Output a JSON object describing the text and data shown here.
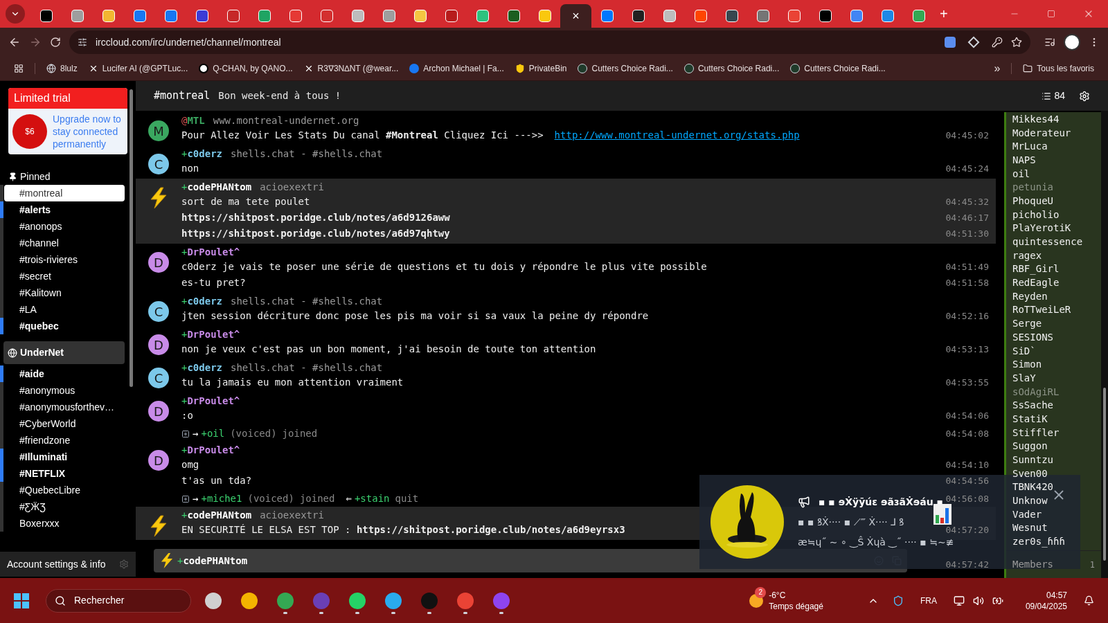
{
  "browser": {
    "tabs": [
      {
        "color": "#000000",
        "selected": false
      },
      {
        "color": "#9e9e9e",
        "selected": false
      },
      {
        "color": "#f2b631",
        "selected": false
      },
      {
        "color": "#1877f2",
        "selected": false
      },
      {
        "color": "#1877f2",
        "selected": false
      },
      {
        "color": "#3b3bd6",
        "selected": false
      },
      {
        "color": "#c62828",
        "selected": false
      },
      {
        "color": "#1fa463",
        "selected": false
      },
      {
        "color": "#e53935",
        "selected": false
      },
      {
        "color": "#d32f2f",
        "selected": false
      },
      {
        "color": "#bdbdbd",
        "selected": false
      },
      {
        "color": "#9e9e9e",
        "selected": false
      },
      {
        "color": "#f4c542",
        "selected": false
      },
      {
        "color": "#b71c1c",
        "selected": false
      },
      {
        "color": "#2ec27e",
        "selected": false
      },
      {
        "color": "#1b5e20",
        "selected": false
      },
      {
        "color": "#f9c80e",
        "selected": false
      },
      {
        "selected": true
      },
      {
        "color": "#0077ff",
        "selected": false
      },
      {
        "color": "#212121",
        "selected": false
      },
      {
        "color": "#bdbdbd",
        "selected": false
      },
      {
        "color": "#ff4500",
        "selected": false
      },
      {
        "color": "#37474f",
        "selected": false
      },
      {
        "color": "#757575",
        "selected": false
      },
      {
        "color": "#ea4335",
        "selected": false
      },
      {
        "color": "#000000",
        "selected": false
      },
      {
        "color": "#4285f4",
        "selected": false
      },
      {
        "color": "#1e88e5",
        "selected": false
      },
      {
        "color": "#34a853",
        "selected": false
      }
    ],
    "close_tab": "×",
    "new_tab": "+",
    "url": "irccloud.com/irc/undernet/channel/montreal",
    "bookmarks": [
      {
        "label": "8lulz",
        "kind": "globe"
      },
      {
        "label": "Lucifer AI (@GPTLuc...",
        "kind": "x"
      },
      {
        "label": "Q-CHAN, by QANO...",
        "kind": "q"
      },
      {
        "label": "R3∇3N∆NT (@wear...",
        "kind": "x"
      },
      {
        "label": "Archon Michael | Fa...",
        "kind": "fb"
      },
      {
        "label": "PrivateBin",
        "kind": "shield"
      },
      {
        "label": "Cutters Choice Radi...",
        "kind": "radio"
      },
      {
        "label": "Cutters Choice Radi...",
        "kind": "radio"
      },
      {
        "label": "Cutters Choice Radi...",
        "kind": "radio"
      }
    ],
    "more": "»",
    "all_bookmarks": "Tous les favoris"
  },
  "sidebar": {
    "trial": {
      "title": "Limited trial",
      "price": "$6",
      "text": "Upgrade now to stay connected permanently"
    },
    "pinned": {
      "title": "Pinned",
      "items": [
        {
          "label": "#montreal",
          "selected": true,
          "unread": false
        },
        {
          "label": "#alerts",
          "selected": false,
          "unread": true
        },
        {
          "label": "#anonops",
          "selected": false,
          "unread": false
        },
        {
          "label": "#channel",
          "selected": false,
          "unread": false
        },
        {
          "label": "#trois-rivieres",
          "selected": false,
          "unread": false
        },
        {
          "label": "#secret",
          "selected": false,
          "unread": false
        },
        {
          "label": "#Kalitown",
          "selected": false,
          "unread": false
        },
        {
          "label": "#LA",
          "selected": false,
          "unread": false
        },
        {
          "label": "#quebec",
          "selected": false,
          "unread": true
        }
      ]
    },
    "network": {
      "title": "UnderNet",
      "items": [
        {
          "label": "#aide",
          "selected": false,
          "unread": true
        },
        {
          "label": "#anonymous",
          "selected": false,
          "unread": false
        },
        {
          "label": "#anonymousforthev…",
          "selected": false,
          "unread": false
        },
        {
          "label": "#CyberWorld",
          "selected": false,
          "unread": false
        },
        {
          "label": "#friendzone",
          "selected": false,
          "unread": false
        },
        {
          "label": "#Illuminati",
          "selected": false,
          "unread": true
        },
        {
          "label": "#NETFLIX",
          "selected": false,
          "unread": true
        },
        {
          "label": "#QuebecLibre",
          "selected": false,
          "unread": false
        },
        {
          "label": "#ƸӜƷ",
          "selected": false,
          "unread": false
        },
        {
          "label": "Boxerxxx",
          "selected": false,
          "unread": false
        }
      ]
    },
    "account": "Account settings & info"
  },
  "channel": {
    "name": "#montreal",
    "topic": "Bon week-end à tous !",
    "member_count": "84"
  },
  "messages": [
    {
      "kind": "user",
      "avatar": "M",
      "color": "#3aa760",
      "prefix": "@",
      "operator": true,
      "nick": "MTL",
      "info": "www.montreal-undernet.org",
      "highlighted": false,
      "lines": [
        {
          "text": "Pour Allez Voir Les Stats Du canal **#Montreal** Cliquez Ici --->>",
          "link": "http://www.montreal-undernet.org/stats.php",
          "time": "04:45:02"
        }
      ]
    },
    {
      "kind": "user",
      "avatar": "C",
      "color": "#7cc8ea",
      "prefix": "+",
      "operator": false,
      "nick": "c0derz",
      "info": "shells.chat - #shells.chat",
      "highlighted": false,
      "lines": [
        {
          "text": "non",
          "time": "04:45:24"
        }
      ]
    },
    {
      "kind": "bolt",
      "prefix": "+",
      "operator": false,
      "nick": "codePHANtom",
      "info": "acioexextri",
      "highlighted": true,
      "lines": [
        {
          "text": "sort de ma tete poulet",
          "time": "04:45:32"
        },
        {
          "text": "**https://shitpost.poridge.club/notes/a6d9126aww**",
          "time": "04:46:17"
        },
        {
          "text": "**https://shitpost.poridge.club/notes/a6d97qhtwy**",
          "time": "04:51:30"
        }
      ]
    },
    {
      "kind": "user",
      "avatar": "D",
      "color": "#c88be8",
      "prefix": "+",
      "operator": false,
      "nick": "DrPoulet^",
      "highlighted": false,
      "lines": [
        {
          "text": "c0derz je vais te poser une série de questions et tu dois y répondre le plus vite possible",
          "time": "04:51:49"
        },
        {
          "text": "es-tu pret?",
          "time": "04:51:58"
        }
      ]
    },
    {
      "kind": "user",
      "avatar": "C",
      "color": "#7cc8ea",
      "prefix": "+",
      "operator": false,
      "nick": "c0derz",
      "info": "shells.chat - #shells.chat",
      "highlighted": false,
      "lines": [
        {
          "text": "jten session décriture donc pose les pis ma voir si sa vaux la peine dy répondre",
          "time": "04:52:16"
        }
      ]
    },
    {
      "kind": "user",
      "avatar": "D",
      "color": "#c88be8",
      "prefix": "+",
      "operator": false,
      "nick": "DrPoulet^",
      "highlighted": false,
      "lines": [
        {
          "text": "non je veux c'est pas un bon moment, j'ai besoin de toute ton attention",
          "time": "04:53:13"
        }
      ]
    },
    {
      "kind": "user",
      "avatar": "C",
      "color": "#7cc8ea",
      "prefix": "+",
      "operator": false,
      "nick": "c0derz",
      "info": "shells.chat - #shells.chat",
      "highlighted": false,
      "lines": [
        {
          "text": "tu la jamais eu mon attention vraiment",
          "time": "04:53:55"
        }
      ]
    },
    {
      "kind": "user",
      "avatar": "D",
      "color": "#c88be8",
      "prefix": "+",
      "operator": false,
      "nick": "DrPoulet^",
      "highlighted": false,
      "lines": [
        {
          "text": ":o",
          "time": "04:54:06"
        }
      ]
    },
    {
      "kind": "event",
      "time": "04:54:08",
      "items": [
        {
          "arrow": "→",
          "prefix": "+",
          "nick": "oil",
          "mode": "(voiced)",
          "action": "joined"
        }
      ]
    },
    {
      "kind": "user",
      "avatar": "D",
      "color": "#c88be8",
      "prefix": "+",
      "operator": false,
      "nick": "DrPoulet^",
      "highlighted": false,
      "lines": [
        {
          "text": "omg",
          "time": "04:54:10"
        },
        {
          "text": "t'as un tda?",
          "time": "04:54:56"
        }
      ]
    },
    {
      "kind": "event",
      "time": "04:56:08",
      "items": [
        {
          "arrow": "→",
          "prefix": "+",
          "nick": "miche1",
          "mode": "(voiced)",
          "action": "joined"
        },
        {
          "arrow": "⇐",
          "prefix": "+",
          "nick": "stain",
          "action": "quit"
        }
      ]
    },
    {
      "kind": "bolt",
      "prefix": "+",
      "operator": false,
      "nick": "codePHANtom",
      "info": "acioexextri",
      "highlighted": true,
      "lines": [
        {
          "text": "EN SECURITÉ LE ELSA EST TOP : **https://shitpost.poridge.club/notes/a6d9eyrsx3**",
          "time": "04:57:20"
        }
      ]
    }
  ],
  "input": {
    "prefix": "+",
    "nick": "codePHANtom",
    "time": "04:57:42"
  },
  "members": {
    "items": [
      {
        "name": "Mikkes44",
        "away": false
      },
      {
        "name": "Moderateur",
        "away": false
      },
      {
        "name": "MrLuca",
        "away": false
      },
      {
        "name": "NAPS",
        "away": false
      },
      {
        "name": "oil",
        "away": false
      },
      {
        "name": "petunia",
        "away": true
      },
      {
        "name": "PhoqueU",
        "away": false
      },
      {
        "name": "picholio",
        "away": false
      },
      {
        "name": "PlaYerotiK",
        "away": false
      },
      {
        "name": "quintessence",
        "away": false
      },
      {
        "name": "ragex",
        "away": false
      },
      {
        "name": "RBF_Girl",
        "away": false
      },
      {
        "name": "RedEagle",
        "away": false
      },
      {
        "name": "Reyden",
        "away": false
      },
      {
        "name": "RoTTweiLeR",
        "away": false
      },
      {
        "name": "Serge",
        "away": false
      },
      {
        "name": "SESIONS",
        "away": false
      },
      {
        "name": "SiD`",
        "away": false
      },
      {
        "name": "Simon",
        "away": false
      },
      {
        "name": "SlaY",
        "away": false
      },
      {
        "name": "sOdAgiRL",
        "away": true
      },
      {
        "name": "SsSache",
        "away": false
      },
      {
        "name": "StatiK",
        "away": false
      },
      {
        "name": "Stiffler",
        "away": false
      },
      {
        "name": "Suggon",
        "away": false
      },
      {
        "name": "Sunntzu",
        "away": false
      },
      {
        "name": "Sven00",
        "away": false
      },
      {
        "name": "TBNK420",
        "away": false
      },
      {
        "name": "Unknow",
        "away": false
      },
      {
        "name": "Vader",
        "away": false
      },
      {
        "name": "Wesnut",
        "away": false
      },
      {
        "name": "zer0s_ɦɦɦ",
        "away": false
      }
    ],
    "footer": "Members",
    "footer_count": "1"
  },
  "notification": {
    "title": "▪ ▪ ɘẊÿȳúɛ ɘãɜãẊɘáu ▪",
    "lines": [
      "▪ ▪ ꝸẊ···· ▪ ⟋‴ Ẋ···· ⅃ ꝸ",
      "æ≒ɥ˝ ∼ ∘ ‿Ŝ Ẋɥà ‿˝ ···· ▪ ≒∼≢"
    ]
  },
  "taskbar": {
    "search": "Rechercher",
    "apps": [
      {
        "color": "#d0d0d0",
        "running": false
      },
      {
        "color": "#f4b400",
        "running": false
      },
      {
        "color": "#34a853",
        "running": true
      },
      {
        "color": "#6a3fb5",
        "running": true
      },
      {
        "color": "#25d366",
        "running": true
      },
      {
        "color": "#2aabee",
        "running": true
      },
      {
        "color": "#111111",
        "running": true
      },
      {
        "color": "#ea4335",
        "running": true
      },
      {
        "color": "#8e44ef",
        "running": true
      }
    ],
    "weather_badge": "2",
    "temperature": "-6°C",
    "weather": "Temps dégagé",
    "language": "FRA",
    "time": "04:57",
    "date": "09/04/2025"
  }
}
